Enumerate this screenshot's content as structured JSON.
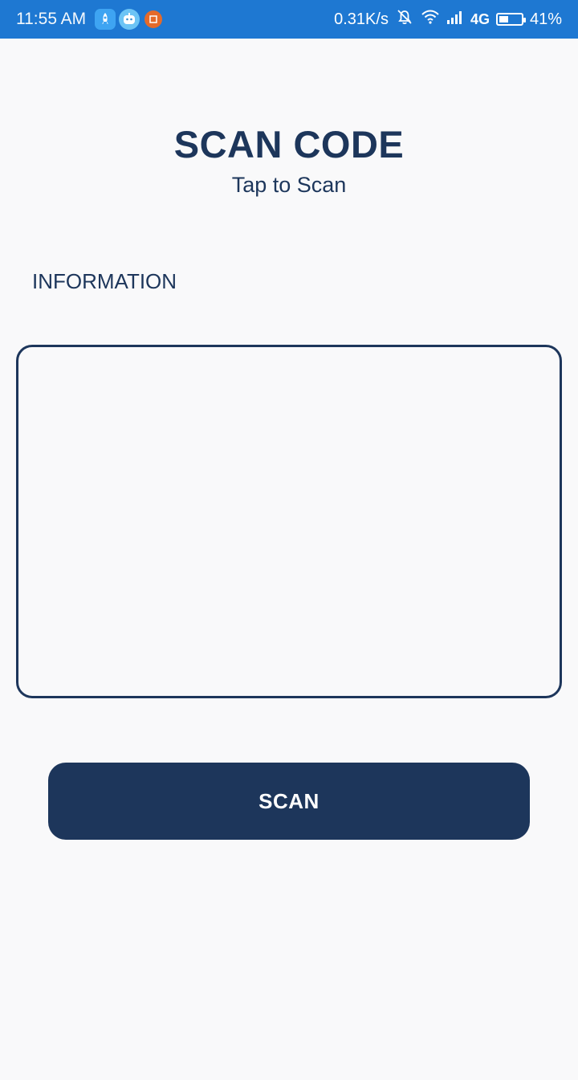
{
  "status_bar": {
    "time": "11:55 AM",
    "net_speed": "0.31K/s",
    "network_type": "4G",
    "battery_percent": "41%",
    "battery_level": 0.41,
    "icons": [
      "rocket-app-icon",
      "robot-app-icon",
      "orange-app-icon",
      "mute-bell-icon",
      "wifi-icon",
      "signal-icon",
      "battery-icon"
    ],
    "background_color": "#1e78d2"
  },
  "page": {
    "title": "SCAN CODE",
    "subtitle": "Tap to Scan",
    "info_label": "INFORMATION",
    "info_text": "",
    "scan_button_label": "SCAN",
    "accent_color": "#1d365b"
  }
}
